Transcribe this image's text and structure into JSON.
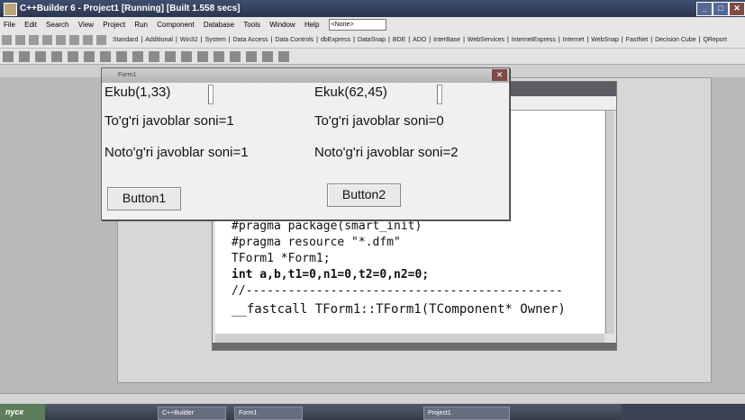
{
  "ide": {
    "title": "C++Builder 6 - Project1 [Running] [Built 1.558 secs]",
    "menu": [
      "File",
      "Edit",
      "Search",
      "View",
      "Project",
      "Run",
      "Component",
      "Database",
      "Tools",
      "Window",
      "Help"
    ],
    "desktop_combo": "<None>",
    "palette_tabs": [
      "Standard",
      "Additional",
      "Win32",
      "System",
      "Data Access",
      "Data Controls",
      "dbExpress",
      "DataSnap",
      "BDE",
      "ADO",
      "InterBase",
      "WebServices",
      "InternetExpress",
      "Internet",
      "WebSnap",
      "FastNet",
      "Decision Cube",
      "QReport"
    ]
  },
  "editor": {
    "code": [
      "#pragma package(smart_init)",
      "#pragma resource \"*.dfm\"",
      "TForm1 *Form1;",
      "int a,b,t1=0,n1=0,t2=0,n2=0;",
      "//---------------------------------------------",
      "__fastcall TForm1::TForm1(TComponent* Owner)"
    ]
  },
  "form1": {
    "title": "Form1",
    "left_label": "Ekub(1,33)",
    "right_label": "Ekuk(62,45)",
    "left_correct": "To'g'ri javoblar soni=1",
    "right_correct": "To'g'ri javoblar soni=0",
    "left_wrong": "Noto'g'ri javoblar soni=1",
    "right_wrong": "Noto'g'ri javoblar soni=2",
    "button1": "Button1",
    "button2": "Button2",
    "close_glyph": "✕"
  },
  "taskbar": {
    "start": "пуск",
    "tasks": [
      "C++Builder",
      "Form1",
      "Project1"
    ]
  }
}
